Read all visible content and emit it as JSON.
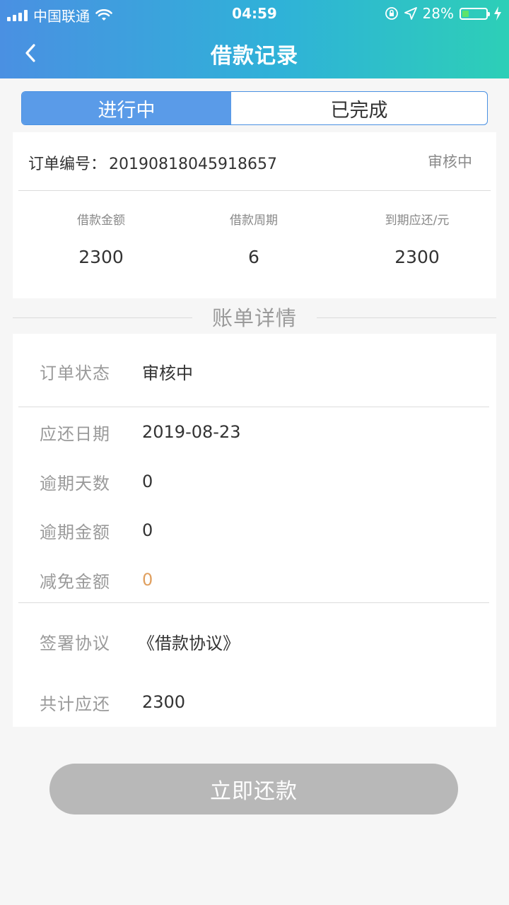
{
  "status_bar": {
    "carrier": "中国联通",
    "time": "04:59",
    "battery": "28%",
    "battery_level": 0.28
  },
  "nav": {
    "title": "借款记录"
  },
  "tabs": [
    {
      "label": "进行中",
      "active": true
    },
    {
      "label": "已完成",
      "active": false
    }
  ],
  "order": {
    "label": "订单编号：",
    "number": "20190818045918657",
    "status": "审核中"
  },
  "stats": [
    {
      "label": "借款金额",
      "value": "2300"
    },
    {
      "label": "借款周期",
      "value": "6"
    },
    {
      "label": "到期应还/元",
      "value": "2300"
    }
  ],
  "section_title": "账单详情",
  "details": [
    {
      "label": "订单状态",
      "value": "审核中"
    },
    {
      "label": "应还日期",
      "value": "2019-08-23"
    },
    {
      "label": "逾期天数",
      "value": "0"
    },
    {
      "label": "逾期金额",
      "value": "0"
    },
    {
      "label": "减免金额",
      "value": "0"
    },
    {
      "label": "签署协议",
      "value": "《借款协议》"
    },
    {
      "label": "共计应还",
      "value": "2300"
    }
  ],
  "pay_button": "立即还款",
  "colors": {
    "header_gradient_start": "#4a90e2",
    "header_gradient_end": "#2dcfb7",
    "tab_active": "#5a9be8",
    "reduction_value": "#e0a060",
    "button_disabled": "#b8b8b8"
  }
}
